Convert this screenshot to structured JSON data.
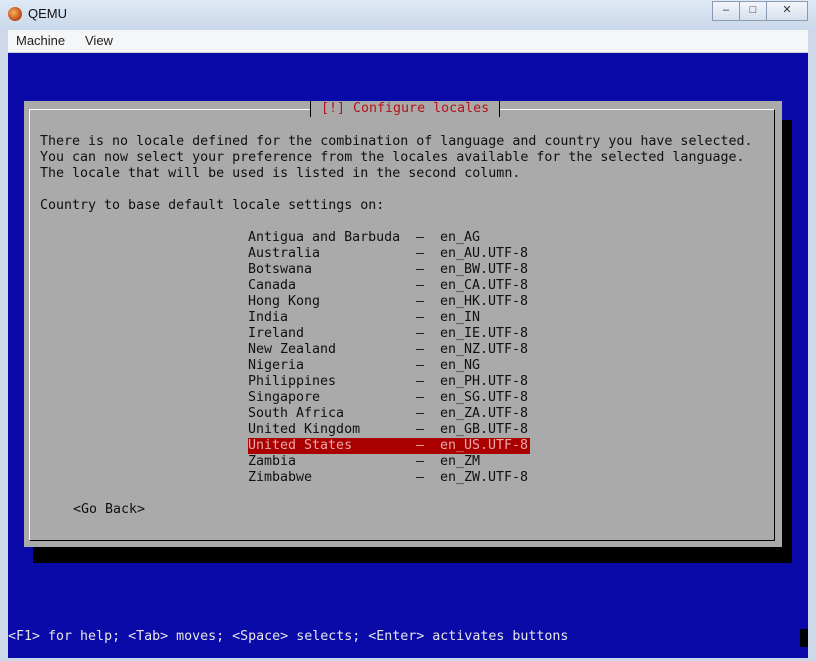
{
  "window": {
    "title": "QEMU",
    "icon": "qemu-icon",
    "controls": {
      "minimize": "–",
      "maximize": "□",
      "close": "✕"
    }
  },
  "menubar": {
    "items": [
      {
        "label": "Machine"
      },
      {
        "label": "View"
      }
    ]
  },
  "dialog": {
    "title": "[!] Configure locales",
    "description": [
      "There is no locale defined for the combination of language and country you have selected.",
      "You can now select your preference from the locales available for the selected language.",
      "The locale that will be used is listed in the second column."
    ],
    "prompt": "Country to base default locale settings on:",
    "options": [
      {
        "country": "Antigua and Barbuda",
        "locale": "en_AG"
      },
      {
        "country": "Australia",
        "locale": "en_AU.UTF-8"
      },
      {
        "country": "Botswana",
        "locale": "en_BW.UTF-8"
      },
      {
        "country": "Canada",
        "locale": "en_CA.UTF-8"
      },
      {
        "country": "Hong Kong",
        "locale": "en_HK.UTF-8"
      },
      {
        "country": "India",
        "locale": "en_IN"
      },
      {
        "country": "Ireland",
        "locale": "en_IE.UTF-8"
      },
      {
        "country": "New Zealand",
        "locale": "en_NZ.UTF-8"
      },
      {
        "country": "Nigeria",
        "locale": "en_NG"
      },
      {
        "country": "Philippines",
        "locale": "en_PH.UTF-8"
      },
      {
        "country": "Singapore",
        "locale": "en_SG.UTF-8"
      },
      {
        "country": "South Africa",
        "locale": "en_ZA.UTF-8"
      },
      {
        "country": "United Kingdom",
        "locale": "en_GB.UTF-8"
      },
      {
        "country": "United States",
        "locale": "en_US.UTF-8"
      },
      {
        "country": "Zambia",
        "locale": "en_ZM"
      },
      {
        "country": "Zimbabwe",
        "locale": "en_ZW.UTF-8"
      }
    ],
    "separator": "–",
    "selected_country": "United States",
    "go_back": "<Go Back>"
  },
  "status_line": "<F1> for help; <Tab> moves; <Space> selects; <Enter> activates buttons",
  "colors": {
    "console_bg": "#0a0aa8",
    "dialog_bg": "#aaaaaa",
    "title_fg": "#b8121b",
    "selected_bg": "#aa0000"
  }
}
